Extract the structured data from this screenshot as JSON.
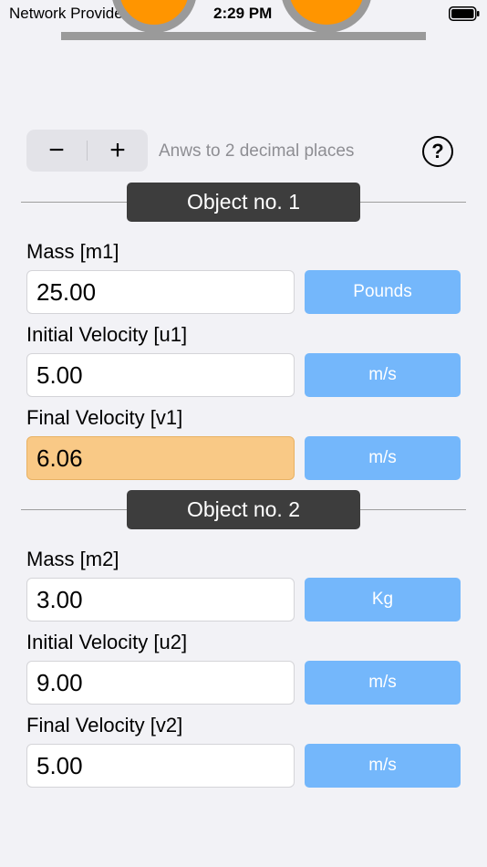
{
  "status_bar": {
    "carrier": "Network Provider",
    "time": "2:29 PM"
  },
  "toolbar": {
    "decrement_label": "−",
    "increment_label": "+",
    "precision_label": "Anws to 2 decimal places",
    "help_label": "?"
  },
  "object1": {
    "title": "Object no. 1",
    "mass_label": "Mass [m1]",
    "mass_value": "25.00",
    "mass_unit": "Pounds",
    "initial_velocity_label": "Initial Velocity [u1]",
    "initial_velocity_value": "5.00",
    "initial_velocity_unit": "m/s",
    "final_velocity_label": "Final Velocity [v1]",
    "final_velocity_value": "6.06",
    "final_velocity_unit": "m/s"
  },
  "object2": {
    "title": "Object no. 2",
    "mass_label": "Mass [m2]",
    "mass_value": "3.00",
    "mass_unit": "Kg",
    "initial_velocity_label": "Initial Velocity [u2]",
    "initial_velocity_value": "9.00",
    "initial_velocity_unit": "m/s",
    "final_velocity_label": "Final Velocity [v2]",
    "final_velocity_value": "5.00",
    "final_velocity_unit": "m/s"
  },
  "colors": {
    "ball": "#ff9500",
    "highlight": "#f9c986",
    "unit_button": "#74b7fb",
    "section_header": "#3d3d3d"
  },
  "icons": {
    "wifi": "wifi-icon",
    "battery": "battery-icon",
    "help": "question-circle-icon"
  }
}
